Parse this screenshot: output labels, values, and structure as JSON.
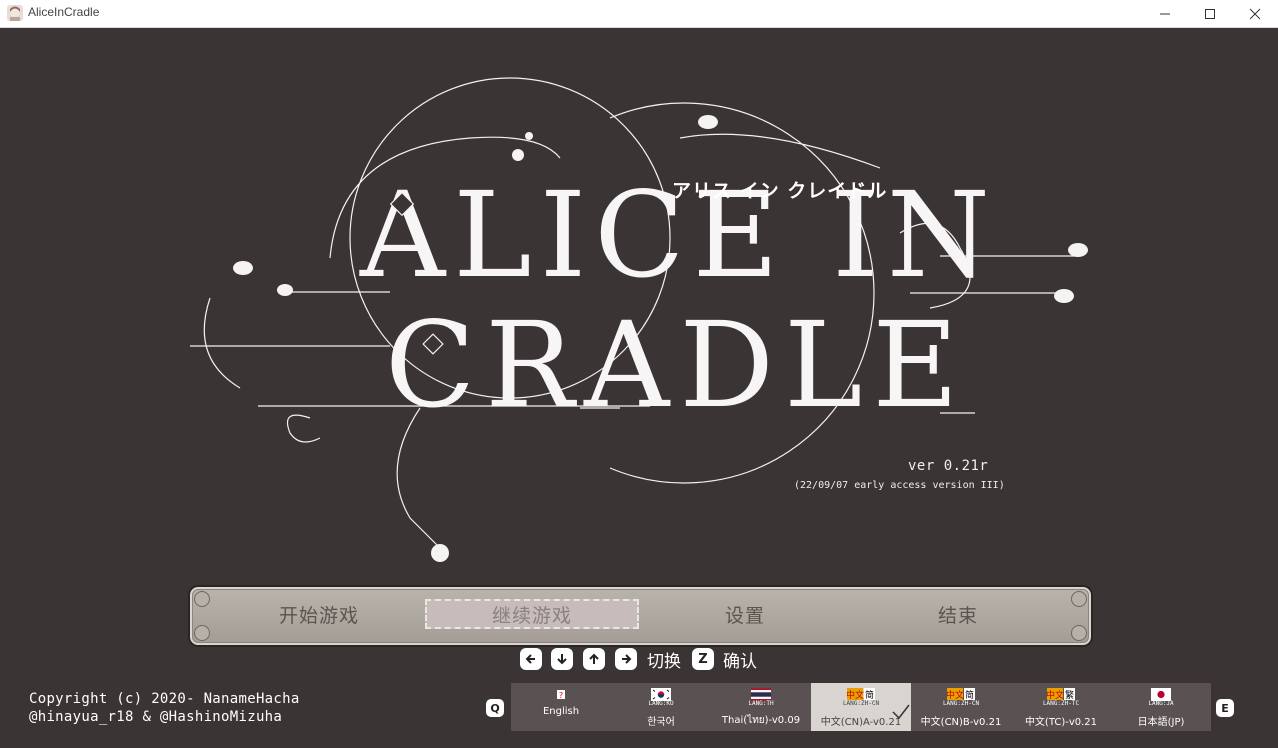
{
  "window": {
    "title": "AliceInCradle",
    "controls": [
      "minimize-icon",
      "maximize-icon",
      "close-icon"
    ]
  },
  "logo": {
    "line1": "ALICE IN",
    "line2": "CRADLE",
    "katakana": "アリス イン クレイドル",
    "version": "ver 0.21r",
    "version_sub": "(22/09/07 early access version III)"
  },
  "menu": {
    "items": [
      "开始游戏",
      "继续游戏",
      "设置",
      "结束"
    ],
    "selected_index": 1
  },
  "controls_hint": {
    "keys": [
      "arrow-left-icon",
      "arrow-down-icon",
      "arrow-up-icon",
      "arrow-right-icon"
    ],
    "switch_label": "切换",
    "confirm_key": "Z",
    "confirm_label": "确认"
  },
  "copyright": {
    "line1": "Copyright (c) 2020- NanameHacha",
    "line2": "@hinayua_r18 & @HashinoMizuha"
  },
  "language": {
    "prev_key": "Q",
    "next_key": "E",
    "selected_index": 3,
    "items": [
      {
        "code": "?",
        "name": "English"
      },
      {
        "code": "LANG:KO",
        "name": "한국어"
      },
      {
        "code": "LANG:TH",
        "name": "Thai(ไทย)-v0.09"
      },
      {
        "code": "LANG:ZH-CN",
        "name": "中文(CN)A-v0.21"
      },
      {
        "code": "LANG:ZH-CN",
        "name": "中文(CN)B-v0.21"
      },
      {
        "code": "LANG:ZH-TC",
        "name": "中文(TC)-v0.21"
      },
      {
        "code": "LANG:JA",
        "name": "日本語(JP)"
      }
    ]
  },
  "colors": {
    "background": "#3a3434",
    "menu_bar": "#b0aaa2",
    "menu_selected": "#c8bcbb",
    "lang_bar": "#5a5252",
    "lang_selected": "#d8d4d0"
  }
}
